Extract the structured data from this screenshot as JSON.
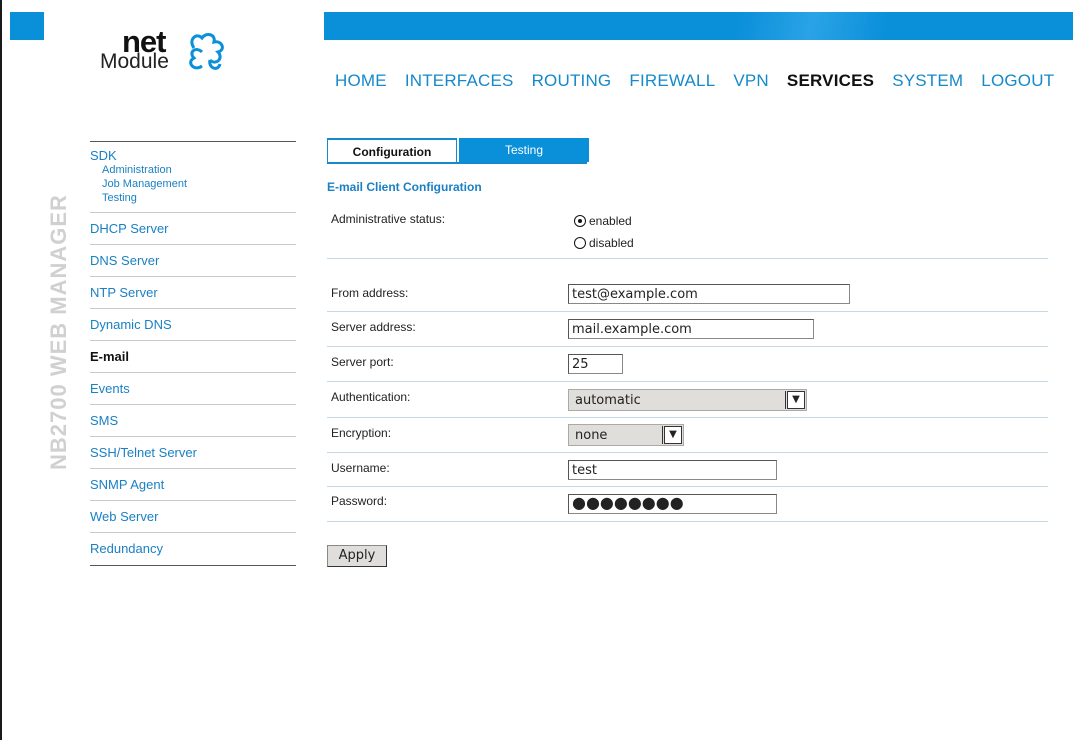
{
  "header": {
    "logo_net": "net",
    "logo_module": "Module",
    "vertical_title": "NB2700 WEB MANAGER"
  },
  "mainnav": {
    "items": [
      {
        "label": "HOME",
        "active": false
      },
      {
        "label": "INTERFACES",
        "active": false
      },
      {
        "label": "ROUTING",
        "active": false
      },
      {
        "label": "FIREWALL",
        "active": false
      },
      {
        "label": "VPN",
        "active": false
      },
      {
        "label": "SERVICES",
        "active": true
      },
      {
        "label": "SYSTEM",
        "active": false
      },
      {
        "label": "LOGOUT",
        "active": false
      }
    ]
  },
  "sidebar": {
    "sdk": {
      "label": "SDK",
      "subitems": [
        "Administration",
        "Job Management",
        "Testing"
      ]
    },
    "items": [
      {
        "label": "DHCP Server"
      },
      {
        "label": "DNS Server"
      },
      {
        "label": "NTP Server"
      },
      {
        "label": "Dynamic DNS"
      },
      {
        "label": "E-mail",
        "active": true
      },
      {
        "label": "Events"
      },
      {
        "label": "SMS"
      },
      {
        "label": "SSH/Telnet Server"
      },
      {
        "label": "SNMP Agent"
      },
      {
        "label": "Web Server"
      },
      {
        "label": "Redundancy"
      }
    ]
  },
  "tabs": {
    "configuration": "Configuration",
    "testing": "Testing"
  },
  "form": {
    "section_title": "E-mail Client Configuration",
    "admin_status_label": "Administrative status:",
    "enabled_label": "enabled",
    "disabled_label": "disabled",
    "admin_status_value": "enabled",
    "from_label": "From address:",
    "from_value": "test@example.com",
    "server_label": "Server address:",
    "server_value": "mail.example.com",
    "port_label": "Server port:",
    "port_value": "25",
    "auth_label": "Authentication:",
    "auth_value": "automatic",
    "enc_label": "Encryption:",
    "enc_value": "none",
    "user_label": "Username:",
    "user_value": "test",
    "pass_label": "Password:",
    "pass_value": "●●●●●●●●",
    "apply_label": "Apply"
  },
  "colors": {
    "accent": "#0a8fd9",
    "link": "#1589c9"
  }
}
